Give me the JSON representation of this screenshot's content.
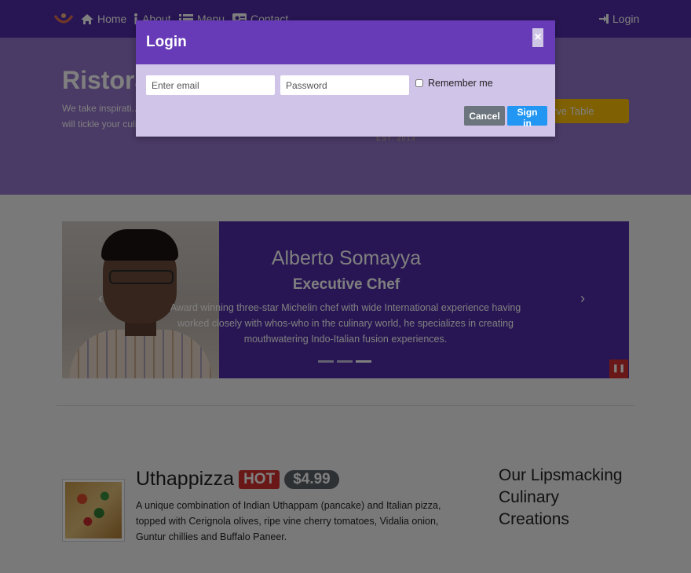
{
  "navbar": {
    "logo_icon": "chef-bowl-logo",
    "items": [
      {
        "label": "Home",
        "icon": "home-icon"
      },
      {
        "label": "About",
        "icon": "info-icon"
      },
      {
        "label": "Menu",
        "icon": "list-icon"
      },
      {
        "label": "Contact",
        "icon": "address-card-icon"
      }
    ],
    "login": {
      "label": "Login",
      "icon": "sign-in-icon"
    }
  },
  "jumbotron": {
    "title": "Ristora",
    "text": "We take inspirati... create a unique f... creations will tickle your culinary senses!",
    "reserve_label": "rve Table",
    "est_text": "EST. 2013"
  },
  "carousel": {
    "name": "Alberto Somayya",
    "role": "Executive Chef",
    "description": "Award winning three-star Michelin chef with wide International experience having worked closely with whos-who in the culinary world, he specializes in creating mouthwatering Indo-Italian fusion experiences.",
    "prev_icon": "chevron-left-icon",
    "next_icon": "chevron-right-icon",
    "indicator_count": 3,
    "active_indicator": 3,
    "pause_icon": "pause-icon"
  },
  "dish": {
    "name": "Uthappizza",
    "hot_label": "HOT",
    "price": "$4.99",
    "description": "A unique combination of Indian Uthappam (pancake) and Italian pizza, topped with Cerignola olives, ripe vine cherry tomatoes, Vidalia onion, Guntur chillies and Buffalo Paneer."
  },
  "side_heading": "Our Lipsmacking Culinary Creations",
  "modal": {
    "title": "Login",
    "close_label": "×",
    "email_placeholder": "Enter email",
    "password_placeholder": "Password",
    "remember_label": "Remember me",
    "cancel_label": "Cancel",
    "signin_label": "Sign in"
  },
  "colors": {
    "primary": "#512da8",
    "modal_header": "#673ab7",
    "modal_body": "#d1c4e9",
    "accent": "#ffc107",
    "danger": "#d32f2f",
    "info": "#2196f3"
  }
}
